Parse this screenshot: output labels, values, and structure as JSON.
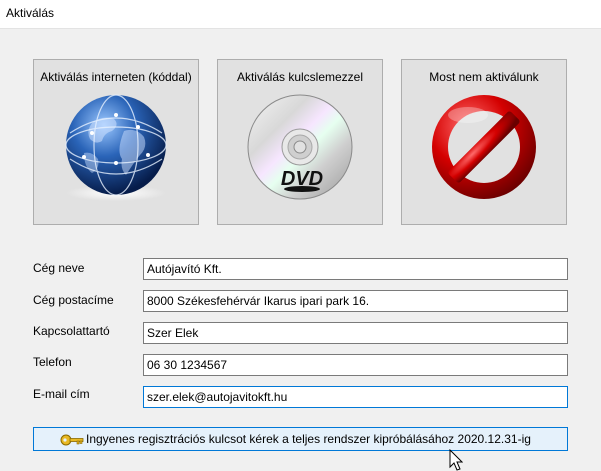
{
  "window": {
    "title": "Aktiválás"
  },
  "options": [
    {
      "label": "Aktiválás interneten (kóddal)",
      "icon": "globe-icon"
    },
    {
      "label": "Aktiválás kulcslemezzel",
      "icon": "dvd-icon"
    },
    {
      "label": "Most nem aktiválunk",
      "icon": "prohibited-icon"
    }
  ],
  "dvd_logo_text": "DVD",
  "form": {
    "company_name": {
      "label": "Cég neve",
      "value": "Autójavító Kft."
    },
    "postal_address": {
      "label": "Cég postacíme",
      "value": "8000 Székesfehérvár Ikarus ipari park 16."
    },
    "contact": {
      "label": "Kapcsolattartó",
      "value": "Szer Elek"
    },
    "phone": {
      "label": "Telefon",
      "value": "06 30 1234567"
    },
    "email": {
      "label": "E-mail cím",
      "value": "szer.elek@autojavitokft.hu"
    }
  },
  "register_button": {
    "label": "Ingyenes regisztrációs kulcsot kérek a teljes rendszer kipróbálásához 2020.12.31-ig",
    "icon": "key-icon"
  },
  "colors": {
    "accent": "#0078d7",
    "button_face": "#e1e1e1",
    "button_hover": "#e5f1fb"
  }
}
